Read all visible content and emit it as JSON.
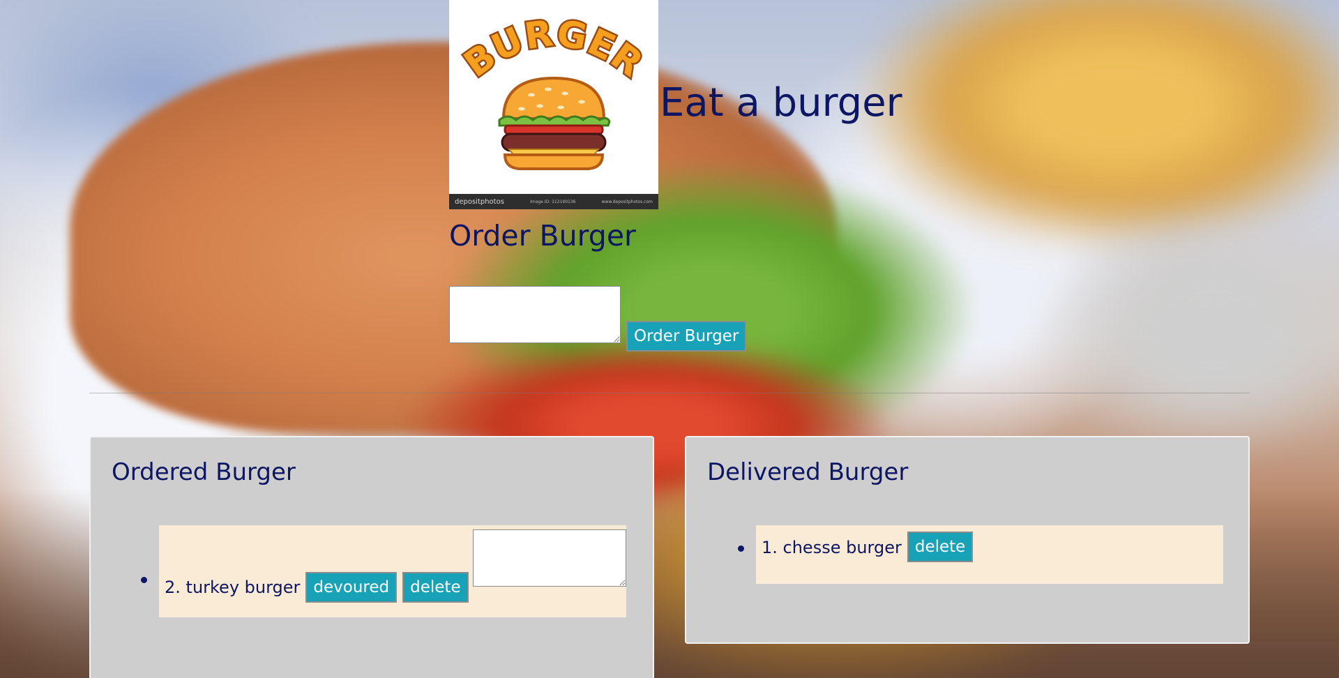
{
  "header": {
    "title": "Eat a burger",
    "logo": {
      "wordmark": "BURGER",
      "footer_brand": "depositphotos",
      "footer_image_id": "Image ID: 112190136",
      "footer_site": "www.depositphotos.com"
    }
  },
  "order": {
    "heading": "Order Burger",
    "textarea_value": "",
    "button_label": "Order Burger"
  },
  "ordered_panel": {
    "title": "Ordered Burger",
    "items": [
      {
        "label": "2. turkey burger",
        "devour_label": "devoured",
        "delete_label": "delete",
        "textarea_value": ""
      }
    ]
  },
  "delivered_panel": {
    "title": "Delivered Burger",
    "items": [
      {
        "label": "1. chesse burger",
        "delete_label": "delete"
      }
    ]
  },
  "colors": {
    "text": "#0d1663",
    "button": "#17a2b8",
    "panel": "#cecece",
    "item_background": "#faebd7"
  }
}
